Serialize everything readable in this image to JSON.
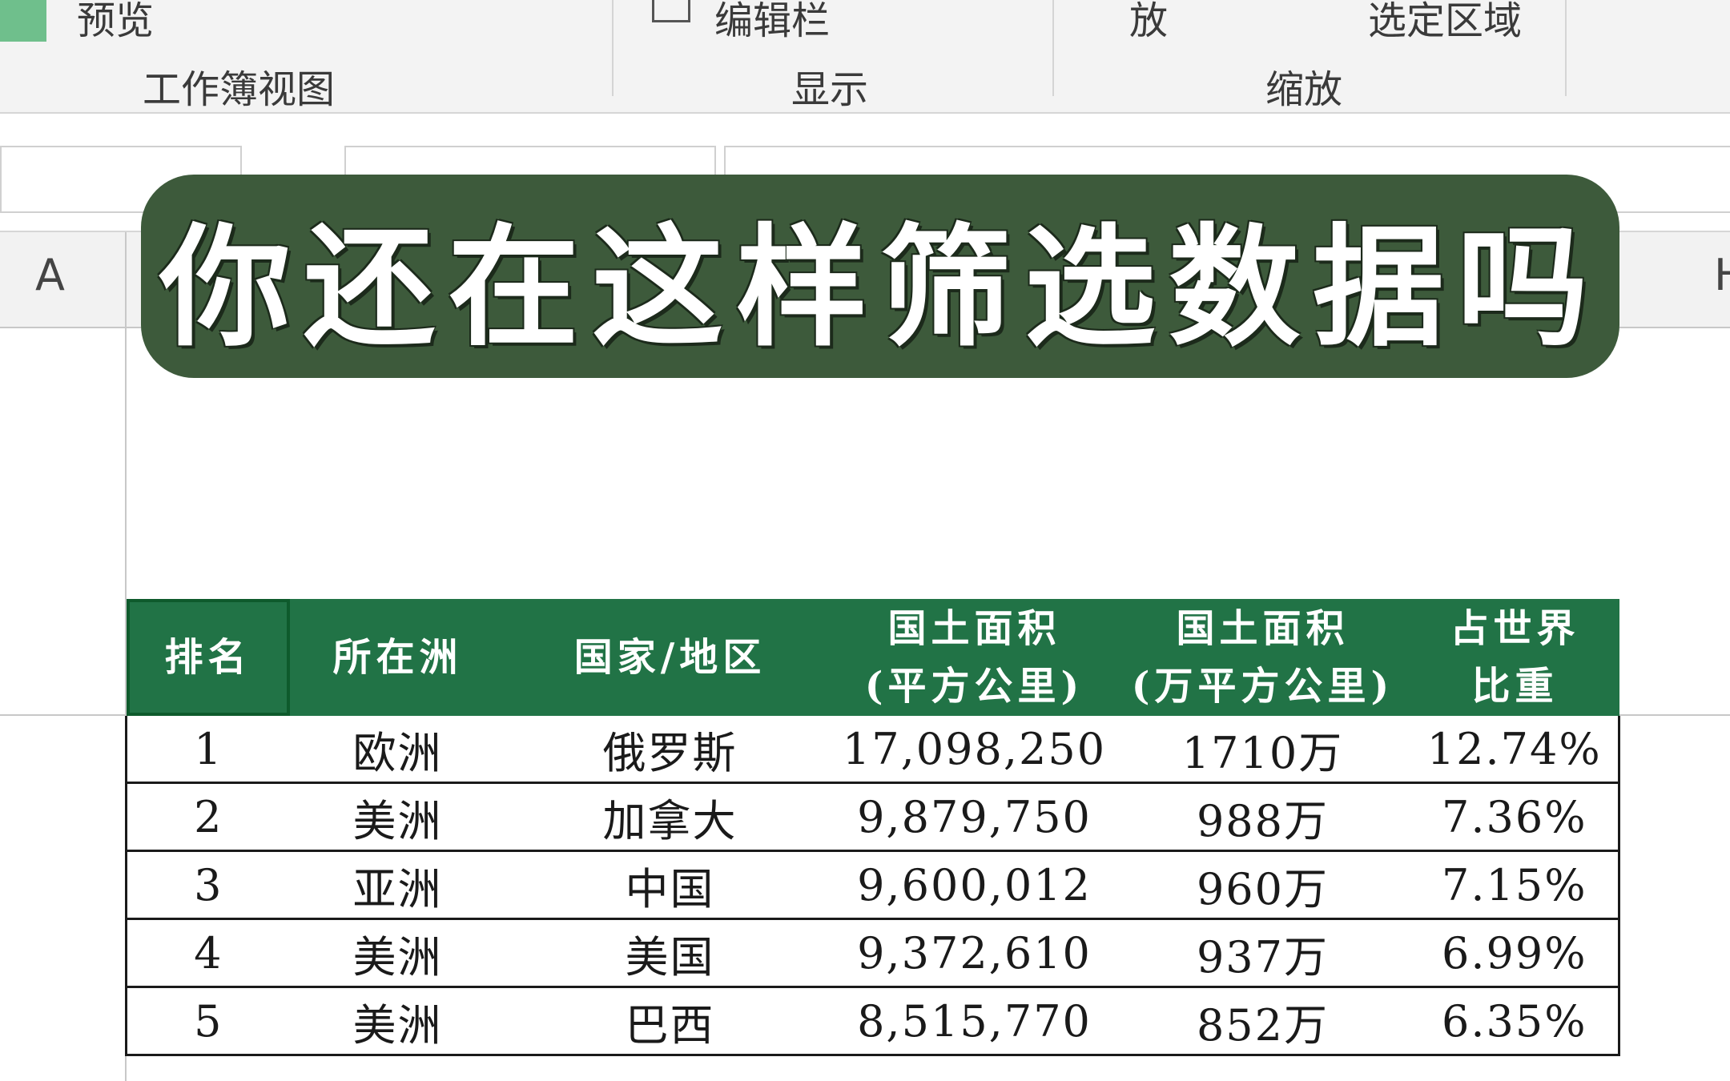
{
  "ribbon": {
    "preview_label": "预览",
    "workbook_views_label": "工作簿视图",
    "formula_bar_label": "编辑栏",
    "show_label": "显示",
    "zoom_partial_label": "放",
    "zoom_selection_label": "选定区域",
    "zoom_label": "缩放"
  },
  "formula_bar": {
    "value": ""
  },
  "columns": {
    "a": "A",
    "h": "H"
  },
  "banner": {
    "title": "你还在这样筛选数据吗"
  },
  "table": {
    "headers": [
      "排名",
      "所在洲",
      "国家/地区",
      "国土面积\n(平方公里)",
      "国土面积\n(万平方公里)",
      "占世界\n比重"
    ],
    "rows": [
      [
        "1",
        "欧洲",
        "俄罗斯",
        "17,098,250",
        "1710万",
        "12.74%"
      ],
      [
        "2",
        "美洲",
        "加拿大",
        "9,879,750",
        "988万",
        "7.36%"
      ],
      [
        "3",
        "亚洲",
        "中国",
        "9,600,012",
        "960万",
        "7.15%"
      ],
      [
        "4",
        "美洲",
        "美国",
        "9,372,610",
        "937万",
        "6.99%"
      ],
      [
        "5",
        "美洲",
        "巴西",
        "8,515,770",
        "852万",
        "6.35%"
      ]
    ]
  },
  "colors": {
    "header_green": "#217346",
    "banner_green": "#3d5a3b"
  }
}
